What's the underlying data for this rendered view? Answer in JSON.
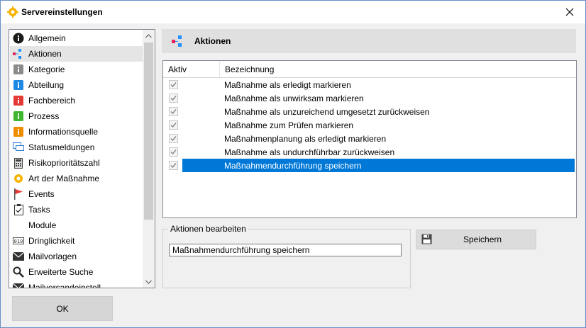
{
  "window": {
    "title": "Servereinstellungen"
  },
  "tree": {
    "items": [
      {
        "label": "Allgemein",
        "icon": "info-black-icon"
      },
      {
        "label": "Aktionen",
        "icon": "actions-icon"
      },
      {
        "label": "Kategorie",
        "icon": "info-gray-icon"
      },
      {
        "label": "Abteilung",
        "icon": "info-blue-icon"
      },
      {
        "label": "Fachbereich",
        "icon": "info-red-icon"
      },
      {
        "label": "Prozess",
        "icon": "info-green-icon"
      },
      {
        "label": "Informationsquelle",
        "icon": "info-orange-icon"
      },
      {
        "label": "Statusmeldungen",
        "icon": "chat-icon"
      },
      {
        "label": "Risikoprioritätszahl",
        "icon": "calculator-icon"
      },
      {
        "label": "Art der Maßnahme",
        "icon": "gear-icon"
      },
      {
        "label": "Events",
        "icon": "flag-icon"
      },
      {
        "label": "Tasks",
        "icon": "clipboard-icon"
      },
      {
        "label": "Module",
        "icon": ""
      },
      {
        "label": "Dringlichkeit",
        "icon": "counter-icon"
      },
      {
        "label": "Mailvorlagen",
        "icon": "mail-icon"
      },
      {
        "label": "Erweiterte Suche",
        "icon": "search-icon"
      },
      {
        "label": "Mailversandeinstell",
        "icon": "mail-settings-icon"
      }
    ],
    "selected_index": 1
  },
  "header": {
    "title": "Aktionen"
  },
  "table": {
    "columns": [
      "Aktiv",
      "Bezeichnung"
    ],
    "rows": [
      {
        "active": true,
        "label": "Maßnahme als erledigt markieren"
      },
      {
        "active": true,
        "label": "Maßnahme als unwirksam markieren"
      },
      {
        "active": true,
        "label": "Maßnahme als unzureichend umgesetzt zurückweisen"
      },
      {
        "active": true,
        "label": "Maßnahme zum Prüfen markieren"
      },
      {
        "active": true,
        "label": "Maßnahmenplanung als erledigt markieren"
      },
      {
        "active": true,
        "label": "Maßnahme als undurchführbar zurückweisen"
      },
      {
        "active": true,
        "label": "Maßnahmendurchführung speichern"
      }
    ],
    "selected_index": 6
  },
  "edit": {
    "group_label": "Aktionen bearbeiten",
    "value": "Maßnahmendurchführung speichern"
  },
  "buttons": {
    "save": "Speichern",
    "ok": "OK"
  },
  "colors": {
    "accent": "#0078d7",
    "actions_pink": "#e8245c",
    "actions_blue": "#1e90ff"
  }
}
